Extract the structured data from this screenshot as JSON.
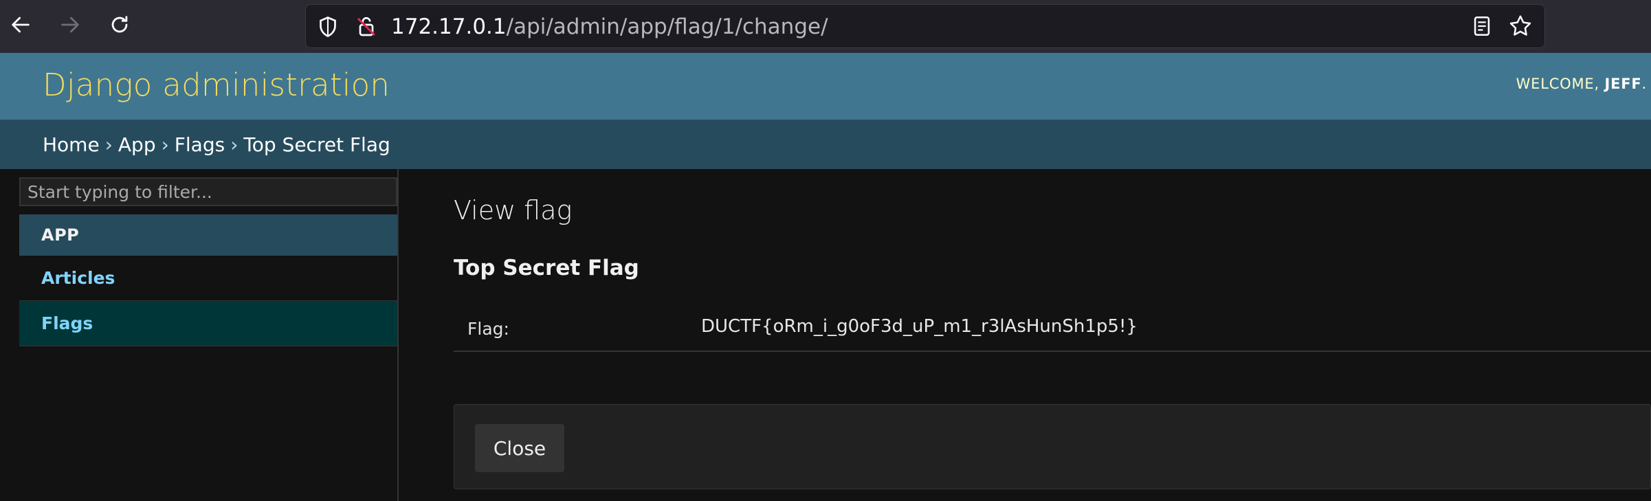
{
  "browser": {
    "url_host": "172.17.0.1",
    "url_path": "/api/admin/app/flag/1/change/"
  },
  "header": {
    "site_title": "Django administration",
    "welcome_text": "WELCOME,",
    "username": "JEFF",
    "username_suffix": "."
  },
  "breadcrumbs": {
    "home": "Home",
    "app": "App",
    "flags": "Flags",
    "current": "Top Secret Flag",
    "separator": "›"
  },
  "sidebar": {
    "filter_placeholder": "Start typing to filter...",
    "module_caption": "APP",
    "items": [
      {
        "label": "Articles"
      },
      {
        "label": "Flags"
      }
    ]
  },
  "main": {
    "heading": "View flag",
    "object_title": "Top Secret Flag",
    "field_label": "Flag:",
    "field_value": "DUCTF{oRm_i_g0oF3d_uP_m1_r3lAsHunSh1p5!}",
    "close_label": "Close"
  },
  "colors": {
    "header_bg": "#417690",
    "breadcrumb_bg": "#264b5d",
    "site_title": "#f5dd5d",
    "link": "#81d4fa",
    "selected_row": "#003637"
  }
}
